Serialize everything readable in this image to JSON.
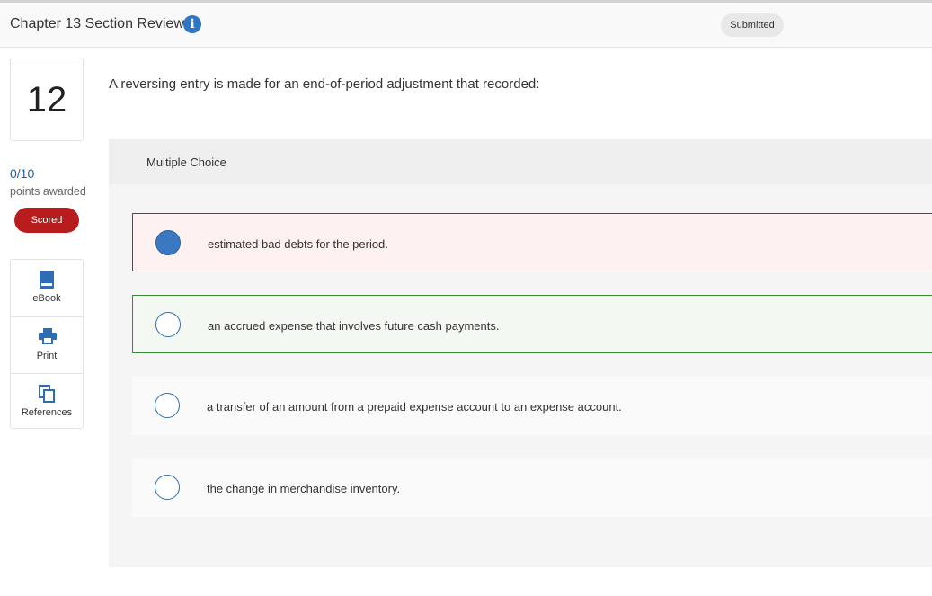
{
  "header": {
    "title": "Chapter 13 Section Review",
    "info_icon": "info-icon",
    "status_badge": "Submitted"
  },
  "sidebar": {
    "question_number": "12",
    "points": "0/10",
    "points_label": "points awarded",
    "scored_label": "Scored",
    "tools": [
      {
        "label": "eBook",
        "icon": "book-icon"
      },
      {
        "label": "Print",
        "icon": "printer-icon"
      },
      {
        "label": "References",
        "icon": "copy-icon"
      }
    ]
  },
  "question": {
    "text": "A reversing entry is made for an end-of-period adjustment that recorded:",
    "type_label": "Multiple Choice",
    "choices": [
      {
        "text": "estimated bad debts for the period.",
        "selected": true,
        "status": "incorrect"
      },
      {
        "text": "an accrued expense that involves future cash payments.",
        "selected": false,
        "status": "correct"
      },
      {
        "text": "a transfer of an amount from a prepaid expense account to an expense account.",
        "selected": false,
        "status": "none"
      },
      {
        "text": "the change in merchandise inventory.",
        "selected": false,
        "status": "none"
      }
    ]
  },
  "colors": {
    "accent": "#2e75c6",
    "scored": "#b91c1c",
    "incorrect_border": "#b02020",
    "correct_border": "#3a8a3a"
  }
}
